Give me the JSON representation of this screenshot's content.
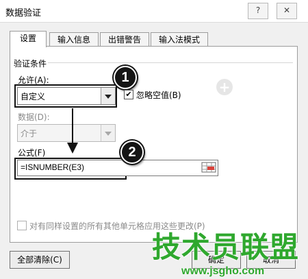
{
  "window": {
    "title": "数据验证",
    "help_glyph": "?",
    "close_glyph": "✕"
  },
  "tabs": [
    {
      "label": "设置"
    },
    {
      "label": "输入信息"
    },
    {
      "label": "出错警告"
    },
    {
      "label": "输入法模式"
    }
  ],
  "settings": {
    "group_title": "验证条件",
    "allow_label": "允许(A):",
    "allow_value": "自定义",
    "ignore_blank_label": "忽略空值(B)",
    "ignore_blank_checked": true,
    "data_label": "数据(D):",
    "data_value": "介于",
    "formula_label": "公式(F)",
    "formula_value": "=ISNUMBER(E3)",
    "apply_all_label": "对有同样设置的所有其他单元格应用这些更改(P)",
    "apply_all_checked": false
  },
  "annotations": {
    "badge1": "1",
    "badge2": "2"
  },
  "buttons": {
    "clear_all": "全部清除(C)",
    "ok": "确定",
    "cancel": "取消"
  },
  "watermark": {
    "text": "技术员联盟",
    "url": "www.jsgho.com",
    "color": "#2fa82e"
  },
  "colors": {
    "annotation": "#151515",
    "panel": "#ffffff",
    "dialog": "#f0f0f0"
  },
  "icons": {
    "check": "✔",
    "plus": "+"
  }
}
